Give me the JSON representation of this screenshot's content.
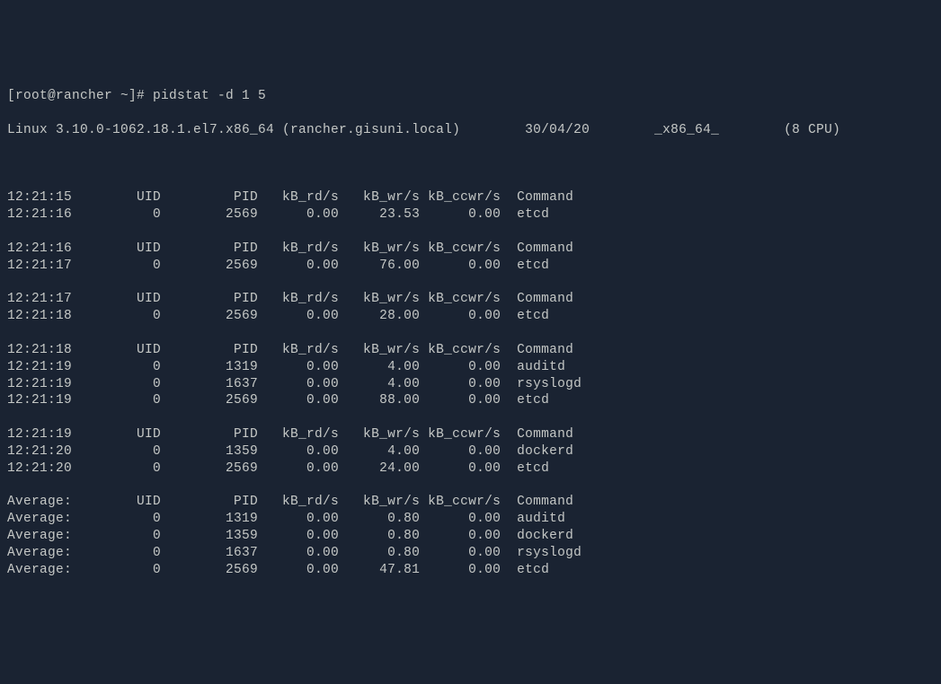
{
  "prompt": "[root@rancher ~]# pidstat -d 1 5",
  "sysinfo": {
    "kernel": "Linux 3.10.0-1062.18.1.el7.x86_64 (rancher.gisuni.local)",
    "date": "30/04/20",
    "arch": "_x86_64_",
    "cpus": "(8 CPU)"
  },
  "headers": {
    "col1": "UID",
    "col2": "PID",
    "col3": "kB_rd/s",
    "col4": "kB_wr/s",
    "col5": "kB_ccwr/s",
    "col6": "Command"
  },
  "blocks": [
    {
      "time_header": "12:21:15",
      "rows": [
        {
          "time": "12:21:16",
          "uid": "0",
          "pid": "2569",
          "rd": "0.00",
          "wr": "23.53",
          "ccwr": "0.00",
          "cmd": "etcd"
        }
      ]
    },
    {
      "time_header": "12:21:16",
      "rows": [
        {
          "time": "12:21:17",
          "uid": "0",
          "pid": "2569",
          "rd": "0.00",
          "wr": "76.00",
          "ccwr": "0.00",
          "cmd": "etcd"
        }
      ]
    },
    {
      "time_header": "12:21:17",
      "rows": [
        {
          "time": "12:21:18",
          "uid": "0",
          "pid": "2569",
          "rd": "0.00",
          "wr": "28.00",
          "ccwr": "0.00",
          "cmd": "etcd"
        }
      ]
    },
    {
      "time_header": "12:21:18",
      "rows": [
        {
          "time": "12:21:19",
          "uid": "0",
          "pid": "1319",
          "rd": "0.00",
          "wr": "4.00",
          "ccwr": "0.00",
          "cmd": "auditd"
        },
        {
          "time": "12:21:19",
          "uid": "0",
          "pid": "1637",
          "rd": "0.00",
          "wr": "4.00",
          "ccwr": "0.00",
          "cmd": "rsyslogd"
        },
        {
          "time": "12:21:19",
          "uid": "0",
          "pid": "2569",
          "rd": "0.00",
          "wr": "88.00",
          "ccwr": "0.00",
          "cmd": "etcd"
        }
      ]
    },
    {
      "time_header": "12:21:19",
      "rows": [
        {
          "time": "12:21:20",
          "uid": "0",
          "pid": "1359",
          "rd": "0.00",
          "wr": "4.00",
          "ccwr": "0.00",
          "cmd": "dockerd"
        },
        {
          "time": "12:21:20",
          "uid": "0",
          "pid": "2569",
          "rd": "0.00",
          "wr": "24.00",
          "ccwr": "0.00",
          "cmd": "etcd"
        }
      ]
    }
  ],
  "average": {
    "label": "Average:",
    "rows": [
      {
        "time": "Average:",
        "uid": "0",
        "pid": "1319",
        "rd": "0.00",
        "wr": "0.80",
        "ccwr": "0.00",
        "cmd": "auditd"
      },
      {
        "time": "Average:",
        "uid": "0",
        "pid": "1359",
        "rd": "0.00",
        "wr": "0.80",
        "ccwr": "0.00",
        "cmd": "dockerd"
      },
      {
        "time": "Average:",
        "uid": "0",
        "pid": "1637",
        "rd": "0.00",
        "wr": "0.80",
        "ccwr": "0.00",
        "cmd": "rsyslogd"
      },
      {
        "time": "Average:",
        "uid": "0",
        "pid": "2569",
        "rd": "0.00",
        "wr": "47.81",
        "ccwr": "0.00",
        "cmd": "etcd"
      }
    ]
  }
}
